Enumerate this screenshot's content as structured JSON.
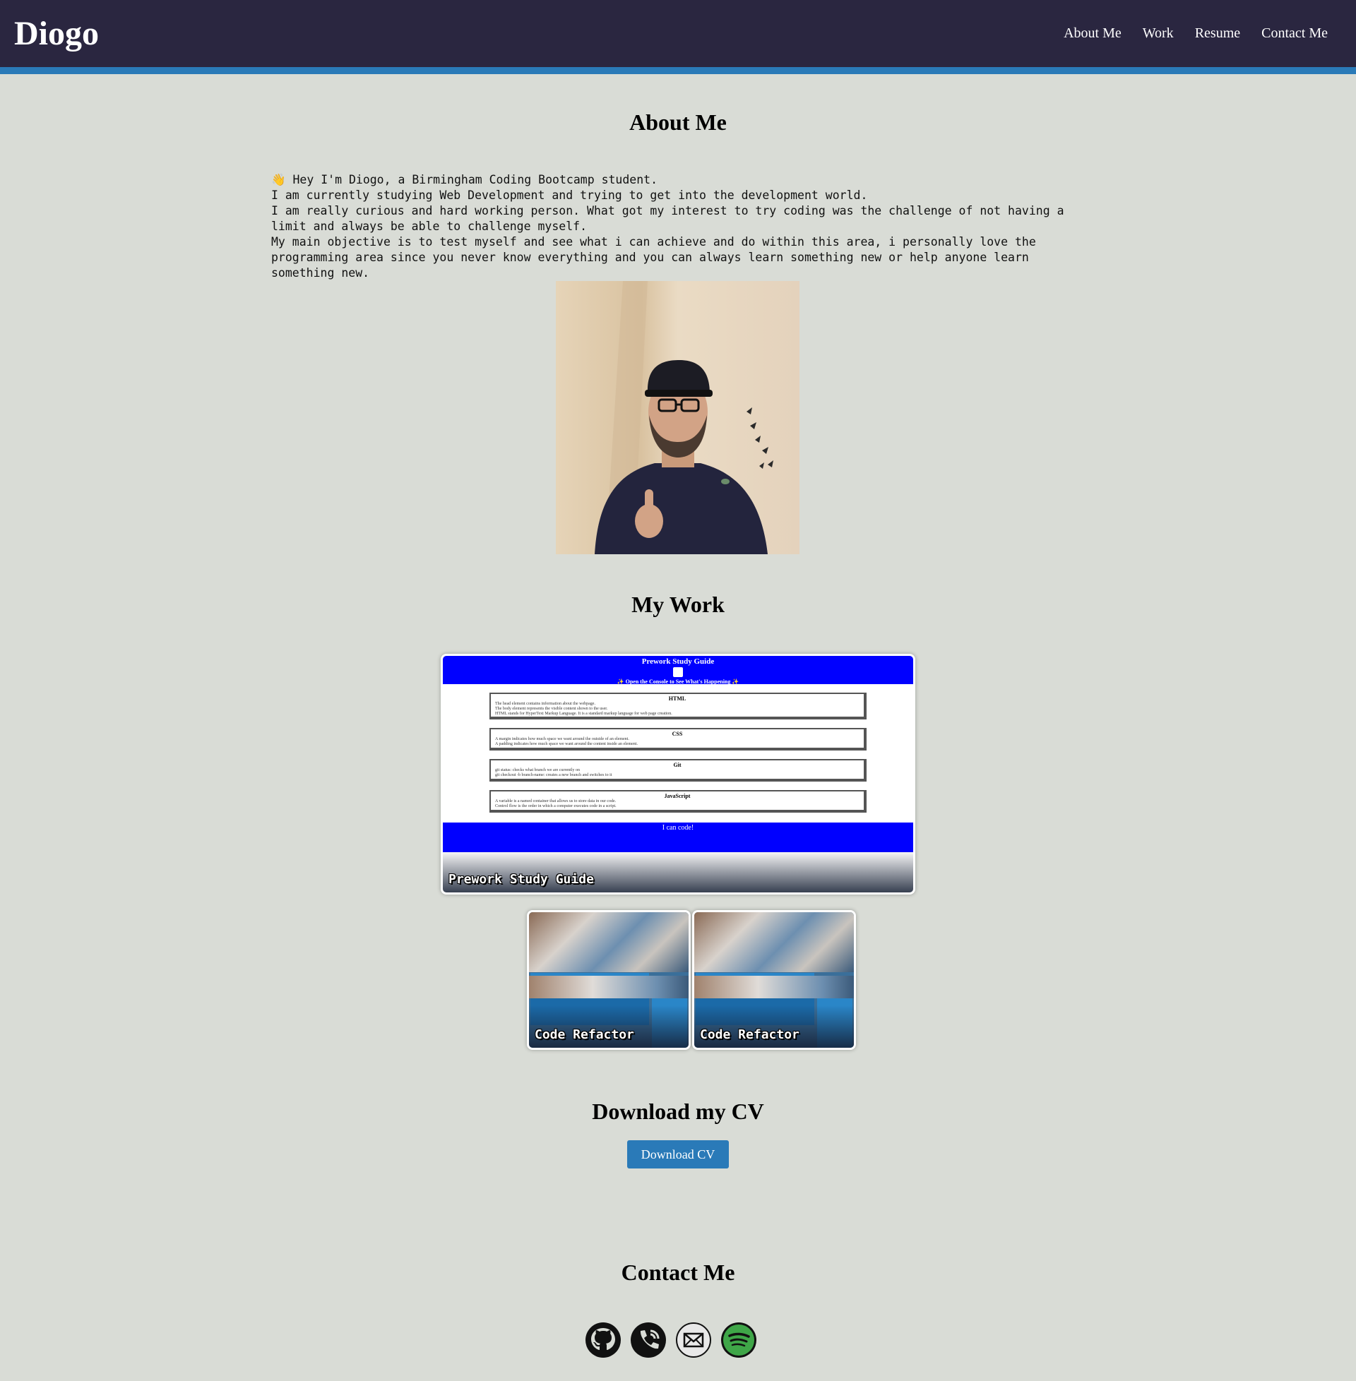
{
  "header": {
    "brand": "Diogo",
    "nav": [
      "About Me",
      "Work",
      "Resume",
      "Contact Me"
    ]
  },
  "about": {
    "heading": "About Me",
    "text": "👋 Hey I'm Diogo, a Birmingham Coding Bootcamp student.\nI am currently studying Web Development and trying to get into the development world.\nI am really curious and hard working person. What got my interest to try coding was the challenge of not having a limit and always be able to challenge myself.\nMy main objective is to test myself and see what i can achieve and do within this area, i personally love the programming area since you never know everything and you can always learn something new or help anyone learn something new."
  },
  "work": {
    "heading": "My Work",
    "projects": [
      {
        "label": "Prework Study Guide",
        "preview": {
          "title": "Prework Study Guide",
          "subtitle": "✨ Open the Console to See What's Happening ✨",
          "sections": [
            {
              "title": "HTML",
              "items": [
                "The head element contains information about the webpage.",
                "The body element represents the visible content shown to the user.",
                "HTML stands for HyperText Markup Language. It is a standard markup language for web page creation."
              ]
            },
            {
              "title": "CSS",
              "items": [
                "A margin indicates how much space we want around the outside of an element.",
                "A padding indicates how much space we want around the content inside an element."
              ]
            },
            {
              "title": "Git",
              "items": [
                "git status: checks what branch we are currently on",
                "git checkout -b branch-name: creates a new branch and switches to it"
              ]
            },
            {
              "title": "JavaScript",
              "items": [
                "A variable is a named container that allows us to store data in our code.",
                "Control flow is the order in which a computer executes code in a script."
              ]
            }
          ],
          "footer": "I can code!"
        }
      },
      {
        "label": "Code Refactor"
      },
      {
        "label": "Code Refactor"
      }
    ]
  },
  "resume": {
    "heading": "Download my CV",
    "button": "Download CV"
  },
  "contact": {
    "heading": "Contact Me",
    "icons": [
      "github-icon",
      "phone-icon",
      "email-icon",
      "spotify-icon"
    ],
    "colors": {
      "spotify": "#3fa648",
      "dark": "#111111"
    }
  }
}
